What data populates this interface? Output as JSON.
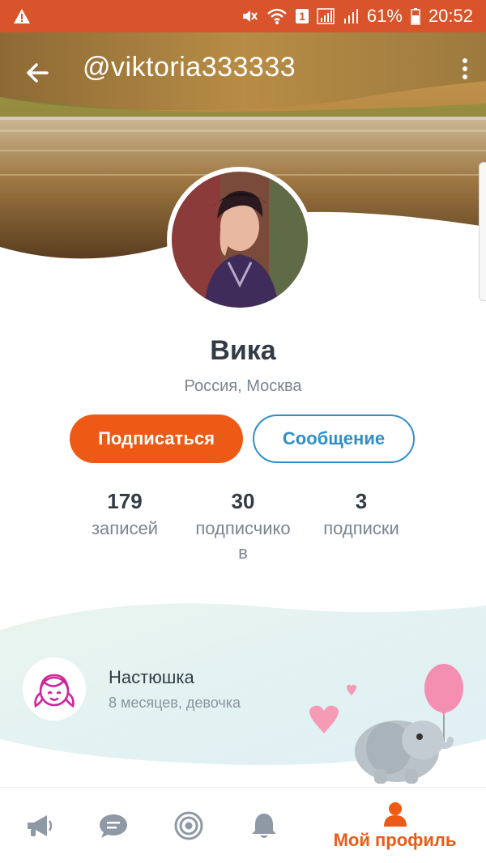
{
  "status_bar": {
    "battery_percent": "61%",
    "time": "20:52",
    "sim_badge": "1",
    "colors": {
      "background": "#d9542b"
    }
  },
  "header": {
    "username": "@viktoria333333",
    "icons": [
      "back-arrow-icon",
      "more-vertical-icon"
    ]
  },
  "profile": {
    "name": "Вика",
    "location": "Россия, Москва"
  },
  "actions": {
    "subscribe_label": "Подписаться",
    "message_label": "Сообщение",
    "colors": {
      "subscribe_bg": "#ee5a16",
      "message_border": "#2f8fca"
    }
  },
  "stats": [
    {
      "value": "179",
      "label": "записей"
    },
    {
      "value": "30",
      "label": "подписчико\nв"
    },
    {
      "value": "3",
      "label": "подписки"
    }
  ],
  "child": {
    "name": "Настюшка",
    "info": "8 месяцев, девочка"
  },
  "bottom_nav": {
    "items": [
      {
        "icon": "megaphone-icon"
      },
      {
        "icon": "chat-bubble-icon"
      },
      {
        "icon": "target-icon"
      },
      {
        "icon": "bell-icon"
      },
      {
        "icon": "person-icon",
        "label": "Мой профиль",
        "active": true
      }
    ],
    "colors": {
      "active": "#ee5a16",
      "inactive": "#8e99a5"
    }
  }
}
